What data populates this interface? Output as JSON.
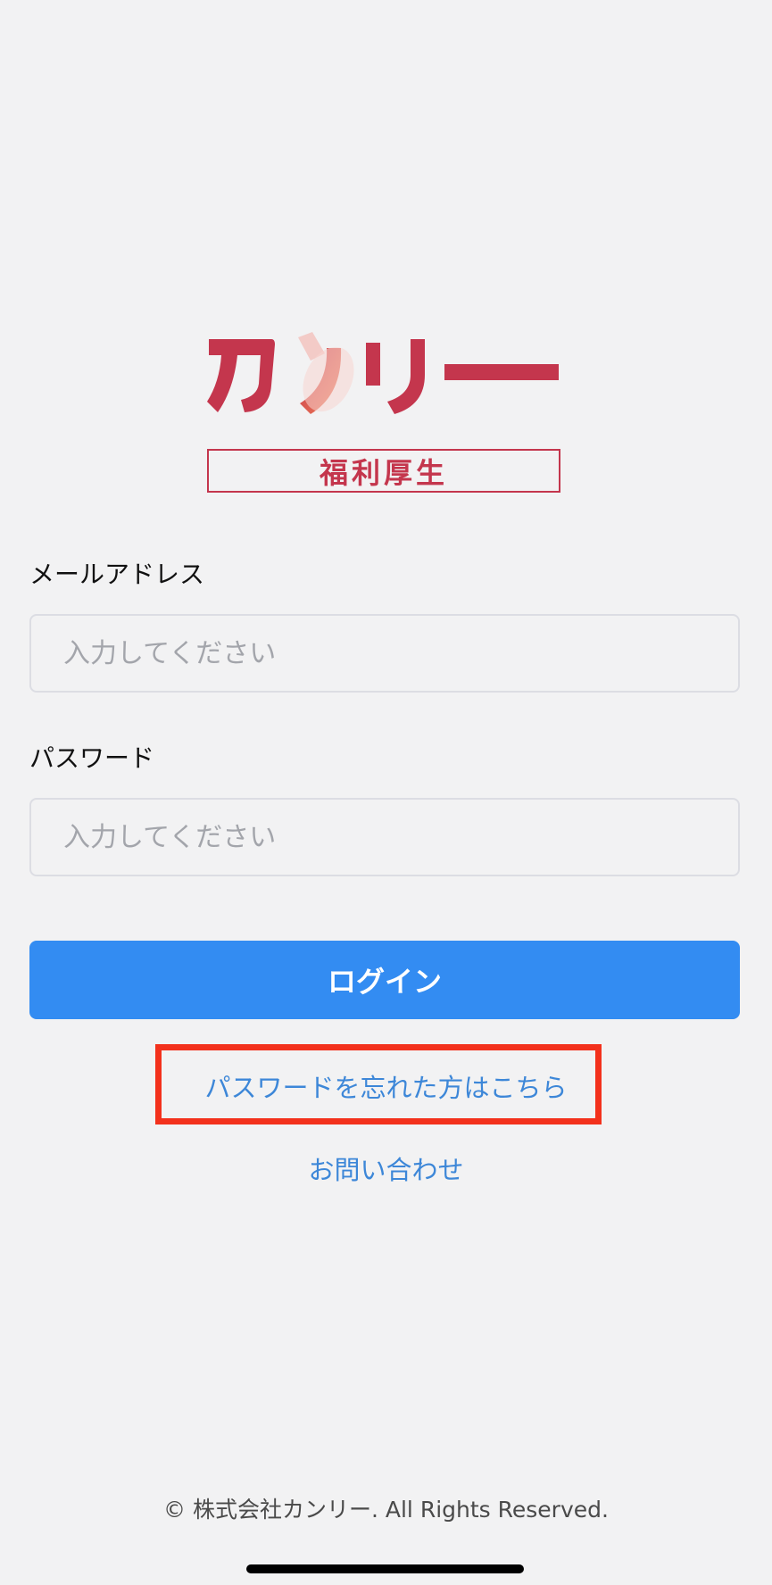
{
  "logo": {
    "main_text": "カンリー",
    "sub_text": "福利厚生",
    "brand_color": "#c4364d",
    "accent_color": "#f07e55"
  },
  "form": {
    "email_label": "メールアドレス",
    "email_placeholder": "入力してください",
    "email_value": "",
    "password_label": "パスワード",
    "password_placeholder": "入力してください",
    "password_value": "",
    "login_button": "ログイン",
    "login_button_color": "#338cf2"
  },
  "links": {
    "forgot_password": "パスワードを忘れた方はこちら",
    "contact": "お問い合わせ",
    "link_color": "#3d87d8"
  },
  "footer": {
    "copyright": "© 株式会社カンリー. All Rights Reserved."
  }
}
